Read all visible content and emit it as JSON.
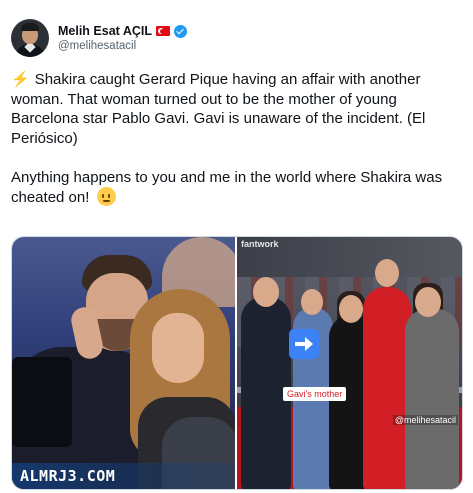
{
  "tweet": {
    "author": {
      "display_name": "Melih Esat AÇIL",
      "handle": "@melihesatacil",
      "flag_icon": "turkey-flag-icon",
      "verified_icon": "verified-badge-icon"
    },
    "text_paragraph_1": "Shakira caught Gerard Pique having an affair with another woman. That woman turned out to be the mother of young Barcelona star Pablo Gavi. Gavi is unaware of the incident. (El Periósico)",
    "text_paragraph_2": "Anything happens to you and me in the world where Shakira was cheated on!",
    "leading_emoji": "⚡",
    "trailing_emoji_icon": "rolling-eyes-emoji-icon"
  },
  "media": {
    "left_image": {
      "watermark": "ALMRJ3.COM"
    },
    "right_image": {
      "screen_text": "fantwork",
      "label": "Gavi's mother",
      "credit": "@melihesatacil",
      "arrow_icon": "right-arrow-icon"
    }
  },
  "colors": {
    "text": "#0f1419",
    "secondary": "#536471",
    "verified": "#1d9bf0",
    "border": "#cfd9de"
  }
}
